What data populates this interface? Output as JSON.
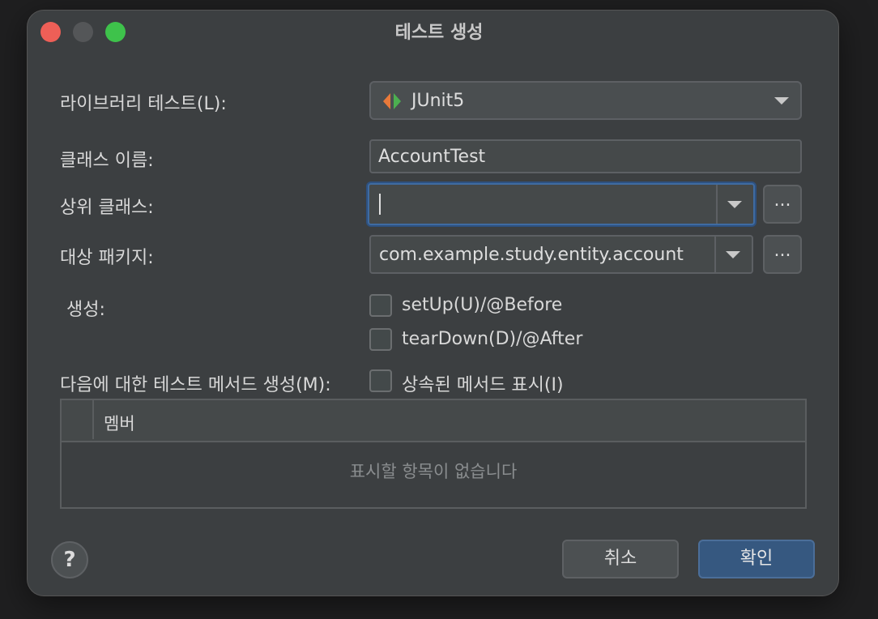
{
  "window": {
    "title": "테스트 생성"
  },
  "form": {
    "library_label": "라이브러리 테스트(L):",
    "library_value": "JUnit5",
    "class_name_label": "클래스 이름:",
    "class_name_value": "AccountTest",
    "superclass_label": "상위 클래스:",
    "superclass_value": "",
    "package_label": "대상 패키지:",
    "package_value": "com.example.study.entity.account",
    "browse_label": "...",
    "generate_label": "생성:",
    "setup_label": "setUp(U)/@Before",
    "teardown_label": "tearDown(D)/@After",
    "methods_label": "다음에 대한 테스트 메서드 생성(M):",
    "inherited_label": "상속된 메서드 표시(I)"
  },
  "table": {
    "column_header": "멤버",
    "empty_text": "표시할 항목이 없습니다"
  },
  "buttons": {
    "help": "?",
    "cancel": "취소",
    "ok": "확인"
  },
  "colors": {
    "accent": "#365880",
    "focus": "#3f6ba1",
    "close": "#ee5f57",
    "maximize": "#3ec24b",
    "junit_left": "#e8793a",
    "junit_right": "#4caf50"
  }
}
